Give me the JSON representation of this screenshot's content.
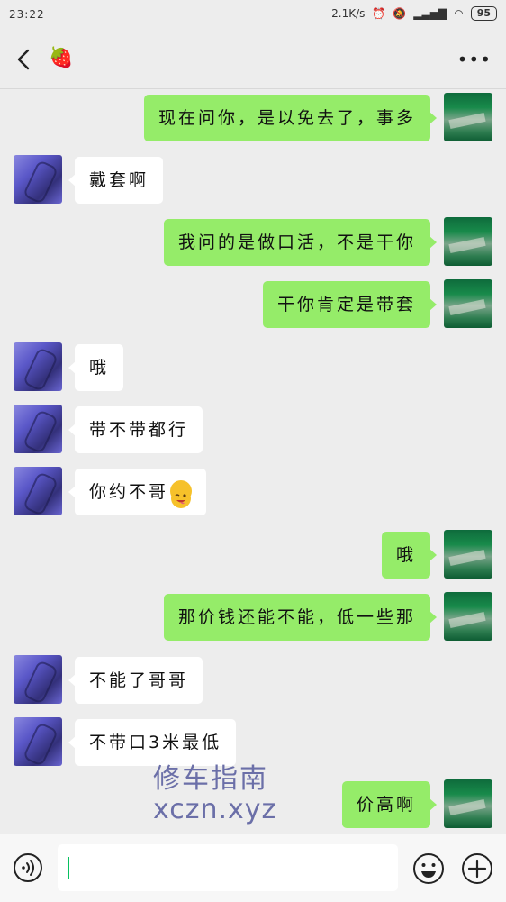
{
  "status_bar": {
    "time": "23:22",
    "speed": "2.1K/s",
    "battery": "95"
  },
  "header": {
    "title_emoji": "🍓"
  },
  "messages": [
    {
      "side": "right",
      "text": "现在问你，是以免去了，事多"
    },
    {
      "side": "left",
      "text": "戴套啊"
    },
    {
      "side": "right",
      "text": "我问的是做口活，不是干你"
    },
    {
      "side": "right",
      "text": "干你肯定是带套"
    },
    {
      "side": "left",
      "text": "哦"
    },
    {
      "side": "left",
      "text": "带不带都行"
    },
    {
      "side": "left",
      "text": "你约不哥"
    },
    {
      "side": "right",
      "text": "哦"
    },
    {
      "side": "right",
      "text": "那价钱还能不能，低一些那"
    },
    {
      "side": "left",
      "text": "不能了哥哥"
    },
    {
      "side": "left",
      "text": "不带口3米最低"
    },
    {
      "side": "right",
      "text": "价高啊"
    }
  ],
  "watermark": {
    "line1": "修车指南",
    "line2": "xczn.xyz"
  },
  "input_bar": {
    "value": ""
  },
  "colors": {
    "background": "#ededed",
    "bubble_sent": "#95ec69",
    "bubble_received": "#ffffff",
    "caret": "#07c160"
  }
}
